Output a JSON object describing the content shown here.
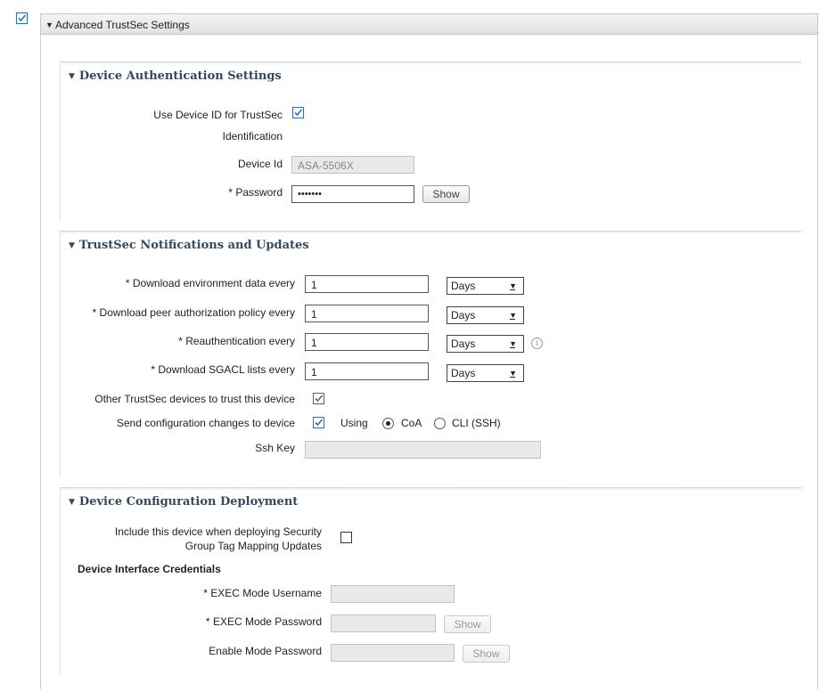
{
  "outer": {
    "title": "Advanced TrustSec Settings",
    "enabled": true
  },
  "auth": {
    "title": "Device Authentication Settings",
    "use_device_id_line1": "Use Device ID for TrustSec",
    "use_device_id_line2": "Identification",
    "use_device_id_checked": true,
    "device_id_label": "Device Id",
    "device_id_value": "ASA-5506X",
    "password_label": "Password",
    "password_value": "•••••••",
    "show_label": "Show"
  },
  "notify": {
    "title": "TrustSec Notifications and Updates",
    "rows": [
      {
        "label": "Download environment data every",
        "value": "1",
        "unit": "Days"
      },
      {
        "label": "Download peer authorization policy every",
        "value": "1",
        "unit": "Days"
      },
      {
        "label": "Reauthentication every",
        "value": "1",
        "unit": "Days"
      },
      {
        "label": "Download SGACL lists every",
        "value": "1",
        "unit": "Days"
      }
    ],
    "trust_label": "Other TrustSec devices to trust this device",
    "trust_checked": true,
    "send_label": "Send configuration changes to device",
    "send_checked": true,
    "using_label": "Using",
    "coa_label": "CoA",
    "cli_label": "CLI (SSH)",
    "selected_method": "CoA",
    "ssh_key_label": "Ssh Key",
    "ssh_key_value": ""
  },
  "deploy": {
    "title": "Device Configuration Deployment",
    "include_line1": "Include this device when deploying Security",
    "include_line2": "Group Tag Mapping Updates",
    "include_checked": false,
    "creds_title": "Device Interface Credentials",
    "exec_user_label": "EXEC Mode Username",
    "exec_pass_label": "EXEC Mode Password",
    "enable_pass_label": "Enable Mode Password",
    "show_label": "Show"
  },
  "colors": {
    "checkbox_border": "#2f6ea8",
    "section_title": "#34495e",
    "disabled_fill": "#e9e9e9"
  }
}
